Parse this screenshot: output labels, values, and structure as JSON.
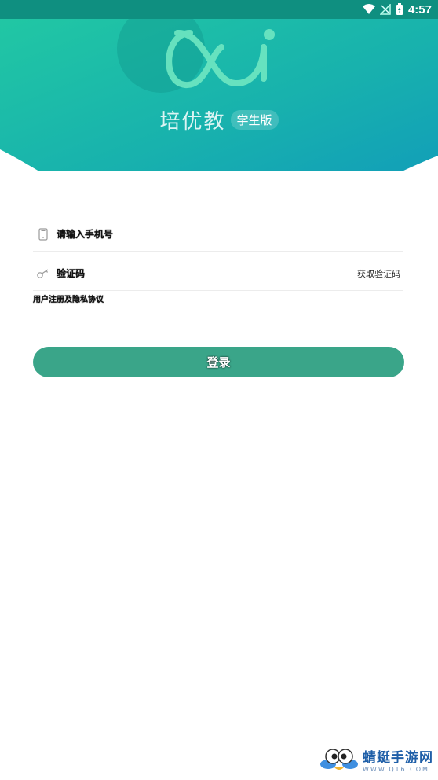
{
  "status_bar": {
    "time": "4:57",
    "icons": [
      "wifi-icon",
      "no-signal-icon",
      "battery-charging-icon"
    ]
  },
  "header": {
    "logo_icon": "ou-logo-icon",
    "app_name": "培优教",
    "edition_badge": "学生版"
  },
  "form": {
    "phone": {
      "icon": "phone-icon",
      "placeholder": "请输入手机号"
    },
    "code": {
      "icon": "key-icon",
      "placeholder": "验证码",
      "action_label": "获取验证码"
    },
    "terms_label": "用户注册及隐私协议",
    "login_label": "登录"
  },
  "watermark": {
    "title": "蜻蜓手游网",
    "url": "WWW.QT6.COM"
  },
  "colors": {
    "header_start": "#1cc7a6",
    "header_end": "#16a8b5",
    "button": "#3aa589"
  }
}
